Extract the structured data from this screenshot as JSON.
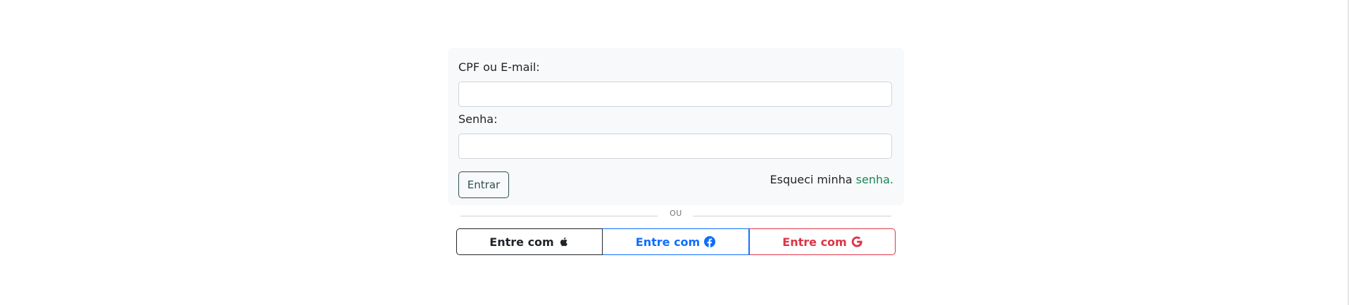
{
  "login": {
    "email_label": "CPF ou E-mail:",
    "email_value": "",
    "password_label": "Senha:",
    "password_value": "",
    "submit_label": "Entrar",
    "forgot_text": "Esqueci minha",
    "forgot_link": "senha."
  },
  "divider": {
    "text": "OU"
  },
  "social": {
    "apple": {
      "label": "Entre com",
      "icon": "apple-icon",
      "color": "#212529"
    },
    "facebook": {
      "label": "Entre com",
      "icon": "facebook-icon",
      "color": "#0d6efd"
    },
    "google": {
      "label": "Entre com",
      "icon": "google-icon",
      "color": "#dc3545"
    }
  },
  "colors": {
    "card_background": "#f8f9fa",
    "submit_border": "#2f4f4f",
    "link": "#198754"
  }
}
